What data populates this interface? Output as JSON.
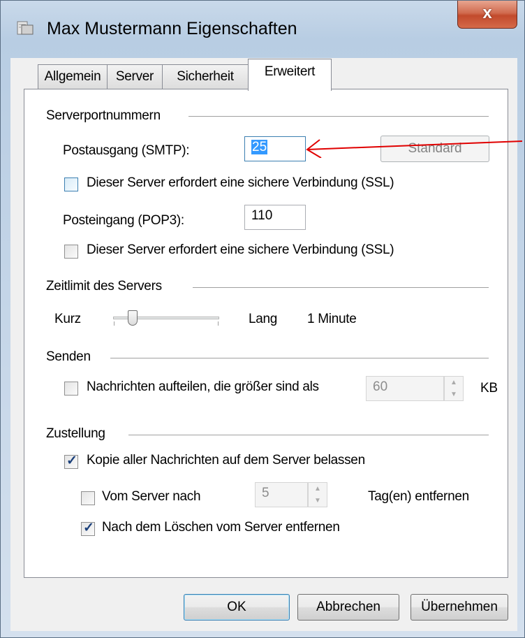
{
  "window": {
    "title": "Max Mustermann Eigenschaften",
    "close_label": "x",
    "icon": "mail-account-icon"
  },
  "tabs": [
    {
      "label": "Allgemein",
      "active": false
    },
    {
      "label": "Server",
      "active": false
    },
    {
      "label": "Sicherheit",
      "active": false
    },
    {
      "label": "Erweitert",
      "active": true
    }
  ],
  "serverports": {
    "group_label": "Serverportnummern",
    "smtp_label": "Postausgang (SMTP):",
    "smtp_value": "25",
    "standard_button": "Standard",
    "smtp_ssl_label": "Dieser Server erfordert eine sichere Verbindung (SSL)",
    "smtp_ssl_checked": false,
    "pop3_label": "Posteingang (POP3):",
    "pop3_value": "110",
    "pop3_ssl_label": "Dieser Server erfordert eine sichere Verbindung (SSL)",
    "pop3_ssl_checked": false
  },
  "timeout": {
    "group_label": "Zeitlimit des Servers",
    "short_label": "Kurz",
    "long_label": "Lang",
    "value_text": "1 Minute",
    "level": 0.15
  },
  "send": {
    "group_label": "Senden",
    "split_label": "Nachrichten aufteilen, die größer sind als",
    "split_checked": false,
    "split_value": "60",
    "unit": "KB"
  },
  "delivery": {
    "group_label": "Zustellung",
    "keep_copy_label": "Kopie aller Nachrichten auf dem Server belassen",
    "keep_copy_checked": true,
    "remove_after_label": "Vom Server nach",
    "remove_after_checked": false,
    "remove_after_value": "5",
    "remove_after_suffix": "Tag(en) entfernen",
    "remove_on_delete_label": "Nach dem Löschen vom Server entfernen",
    "remove_on_delete_checked": true
  },
  "buttons": {
    "ok": "OK",
    "cancel": "Abbrechen",
    "apply": "Übernehmen"
  },
  "annotation": {
    "arrow_color": "#e00000"
  }
}
